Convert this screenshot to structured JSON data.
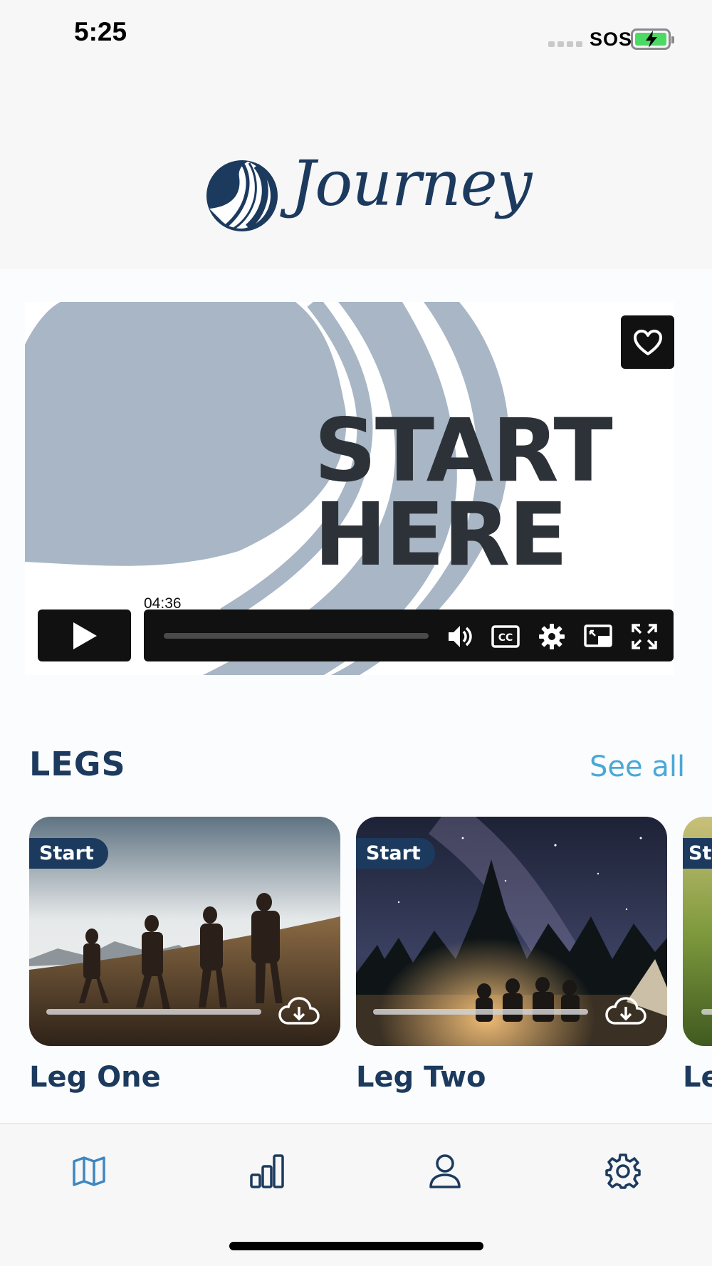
{
  "status": {
    "time": "5:25",
    "carrier": "SOS",
    "battery_charging": true
  },
  "header": {
    "logo_text": "Journey",
    "logo_icon": "road-circle-logo-icon"
  },
  "video": {
    "title_line1": "START",
    "title_line2": "HERE",
    "duration": "04:36",
    "progress_fraction": 0,
    "controls": [
      "volume-icon",
      "captions-icon",
      "settings-icon",
      "pip-icon",
      "fullscreen-icon"
    ],
    "favorite_icon": "heart-icon",
    "play_icon": "play-icon"
  },
  "legs": {
    "title": "LEGS",
    "see_all": "See all",
    "items": [
      {
        "badge": "Start",
        "label": "Leg One",
        "progress_fraction": 0
      },
      {
        "badge": "Start",
        "label": "Leg Two",
        "progress_fraction": 0
      },
      {
        "badge": "St",
        "label": "Le",
        "progress_fraction": 0
      }
    ]
  },
  "tabbar": {
    "tabs": [
      {
        "icon": "map-icon",
        "active": true
      },
      {
        "icon": "bar-chart-icon",
        "active": false
      },
      {
        "icon": "profile-icon",
        "active": false
      },
      {
        "icon": "gear-icon",
        "active": false
      }
    ]
  },
  "colors": {
    "brand_navy": "#1c3a5e",
    "link_blue": "#4aa8d8",
    "active_tab": "#3f86c0",
    "video_shape": "#a8b6c5"
  }
}
